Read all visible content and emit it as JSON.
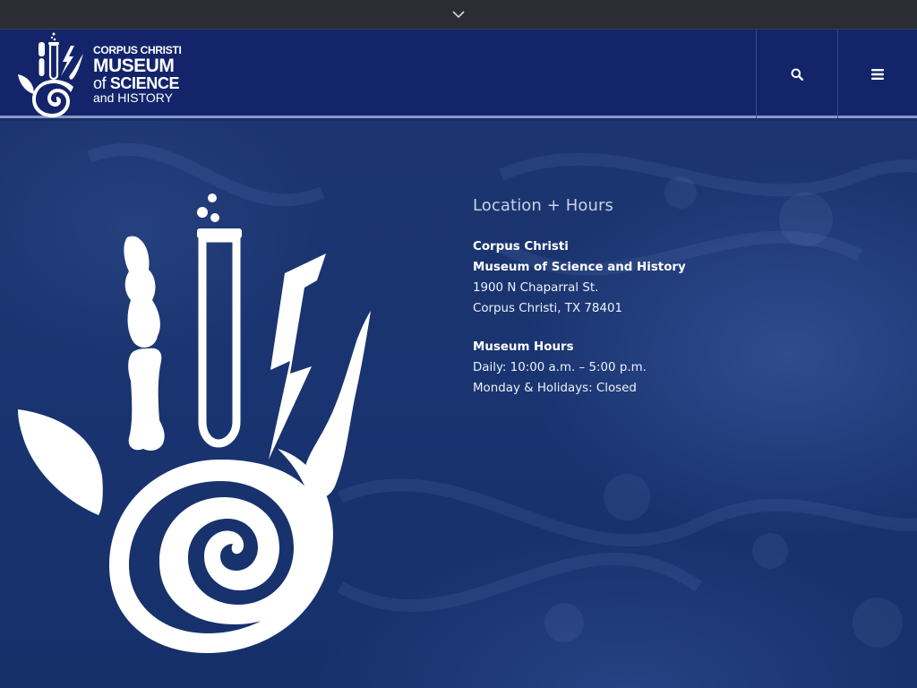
{
  "topbar": {
    "toggle_icon": "chevron-down-icon"
  },
  "header": {
    "logo": {
      "line1": "CORPUS CHRISTI",
      "line2": "MUSEUM",
      "line3_a": "of",
      "line3_b": "SCIENCE",
      "line4": "and HISTORY"
    },
    "search_icon": "search-icon",
    "menu_icon": "hamburger-menu-icon"
  },
  "info": {
    "heading": "Location + Hours",
    "name_line1": "Corpus Christi",
    "name_line2": "Museum of Science and History",
    "address_line1": "1900 N Chaparral St.",
    "address_line2": "Corpus Christi, TX 78401",
    "hours_heading": "Museum Hours",
    "hours_line1": "Daily: 10:00 a.m. – 5:00 p.m.",
    "hours_line2": "Monday & Holidays: Closed"
  },
  "colors": {
    "topbar": "#2a2d33",
    "header": "#13246a",
    "hero": "#1a3470",
    "heading_text": "#c9d1e6"
  }
}
